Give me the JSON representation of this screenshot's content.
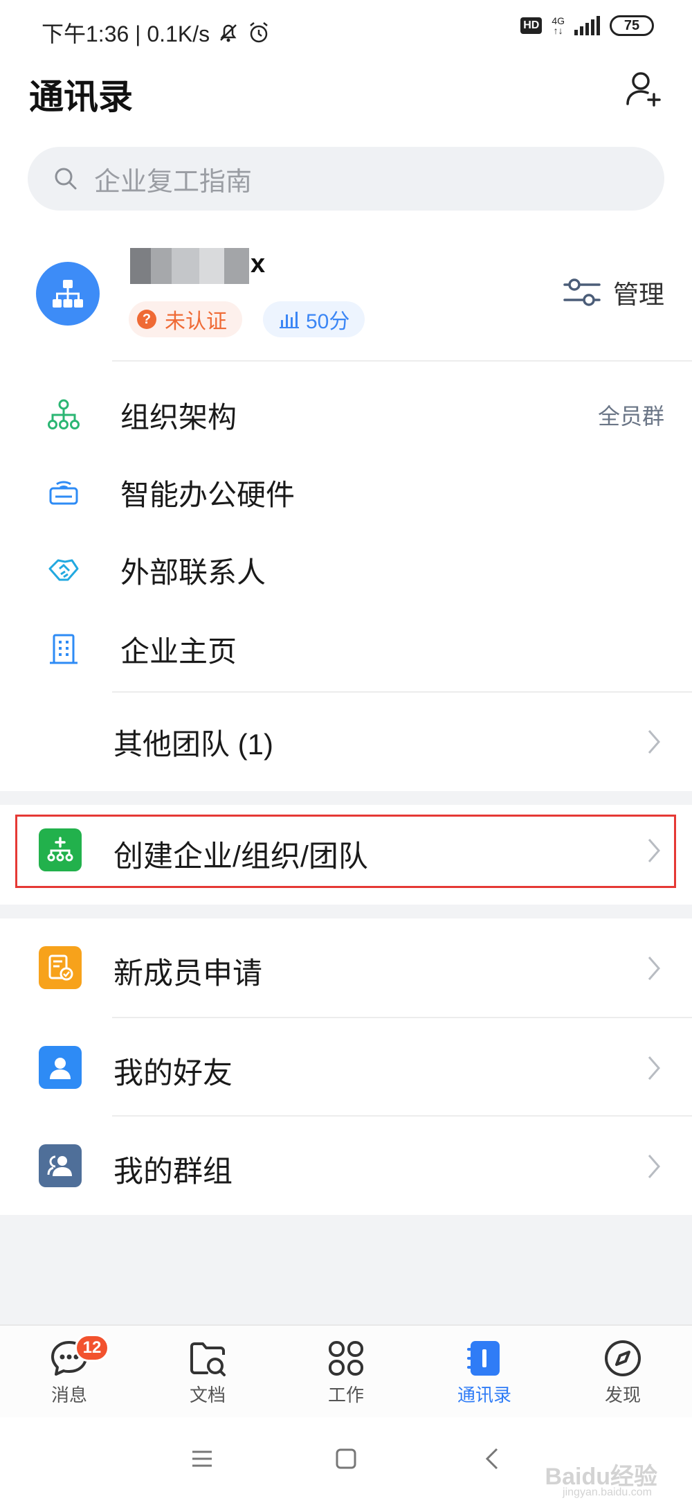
{
  "status_bar": {
    "time_speed": "下午1:36 | 0.1K/s",
    "hd": "HD",
    "network": "4G",
    "battery": "75"
  },
  "header": {
    "title": "通讯录",
    "add_icon": "add-contact-icon"
  },
  "search": {
    "placeholder": "企业复工指南"
  },
  "org": {
    "name_visible_suffix": "x",
    "unverified_label": "未认证",
    "score_label": "50分",
    "manage_label": "管理"
  },
  "org_menu": [
    {
      "label": "组织架构",
      "right_text": "全员群",
      "icon": "org-structure-icon"
    },
    {
      "label": "智能办公硬件",
      "icon": "hardware-icon"
    },
    {
      "label": "外部联系人",
      "icon": "handshake-icon"
    },
    {
      "label": "企业主页",
      "icon": "building-icon"
    }
  ],
  "other_teams": {
    "label": "其他团队 (1)"
  },
  "create_org": {
    "label": "创建企业/组织/团队",
    "icon": "create-org-icon"
  },
  "list": [
    {
      "label": "新成员申请",
      "icon": "new-member-icon"
    },
    {
      "label": "我的好友",
      "icon": "friend-icon"
    },
    {
      "label": "我的群组",
      "icon": "group-icon"
    }
  ],
  "tabbar": [
    {
      "label": "消息",
      "badge": "12",
      "icon": "message-icon"
    },
    {
      "label": "文档",
      "icon": "document-icon"
    },
    {
      "label": "工作",
      "icon": "work-grid-icon"
    },
    {
      "label": "通讯录",
      "icon": "contacts-icon",
      "active": true
    },
    {
      "label": "发现",
      "icon": "compass-icon"
    }
  ],
  "watermark": {
    "text": "Baidu经验",
    "sub": "jingyan.baidu.com"
  },
  "colors": {
    "accent": "#2f7cf6",
    "green": "#22b14c",
    "orange": "#f7a21b",
    "blue": "#2e8bf5",
    "slate": "#4f6f99",
    "warning": "#ef6a35"
  }
}
